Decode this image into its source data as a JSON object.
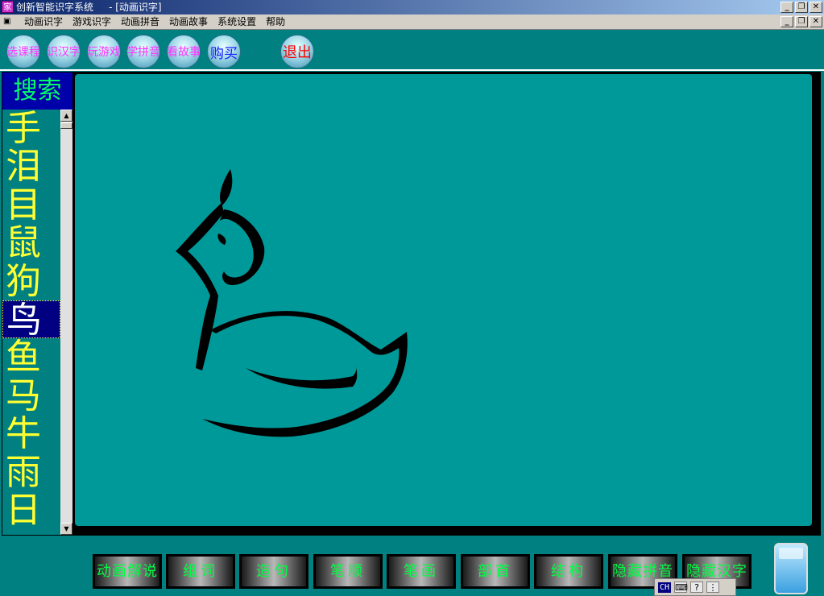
{
  "window": {
    "title": "创新智能识字系统     - [动画识字]",
    "app_icon_text": "家",
    "controls": [
      "_",
      "❐",
      "✕"
    ]
  },
  "menu": {
    "items": [
      "动画识字",
      "游戏识字",
      "动画拼音",
      "动画故事",
      "系统设置",
      "帮助"
    ]
  },
  "toolbar": {
    "buttons": [
      "选课程",
      "识汉字",
      "玩游戏",
      "学拼音",
      "看故事",
      "购买",
      "退出"
    ]
  },
  "left_panel": {
    "search_label": "搜索",
    "characters": [
      "手",
      "泪",
      "目",
      "鼠",
      "狗",
      "鸟",
      "鱼",
      "马",
      "牛",
      "雨",
      "日"
    ],
    "selected_index": 5
  },
  "bottom_buttons": [
    "动画解说",
    "组词",
    "造句",
    "笔顺",
    "笔画",
    "部首",
    "结构",
    "隐藏拼音",
    "隐藏汉字"
  ],
  "ime": {
    "mode": "CH"
  },
  "colors": {
    "background": "#008080",
    "canvas": "#009999",
    "list_text": "#ffff33",
    "search_text": "#00ff66",
    "button_text": "#00ff44"
  }
}
